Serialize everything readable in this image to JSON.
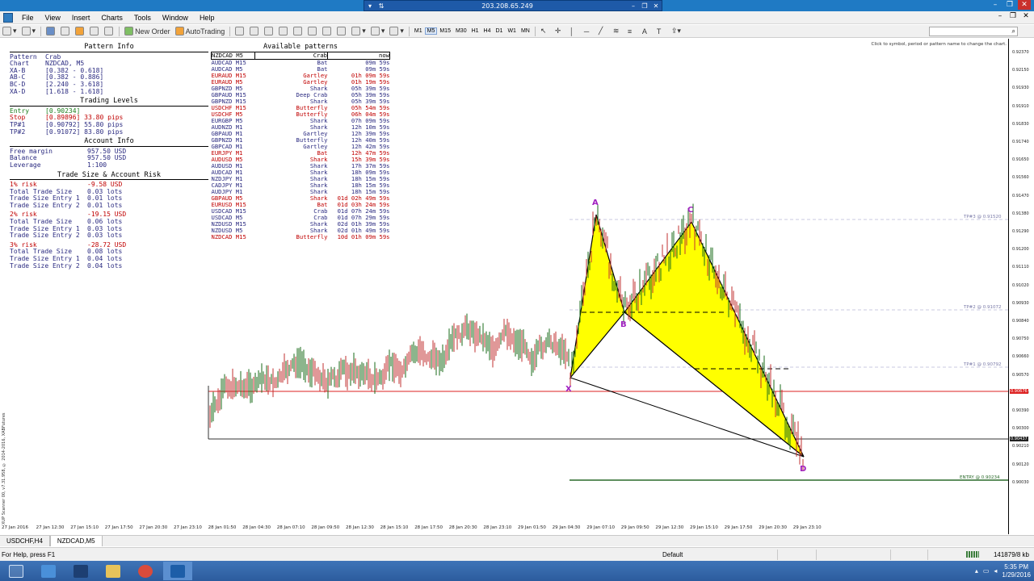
{
  "remote": {
    "address": "203.208.65.249"
  },
  "menu": {
    "items": [
      "File",
      "View",
      "Insert",
      "Charts",
      "Tools",
      "Window",
      "Help"
    ]
  },
  "toolbar": {
    "new_order": "New Order",
    "autotrading": "AutoTrading",
    "timeframes": [
      "M1",
      "M5",
      "M15",
      "M30",
      "H1",
      "H4",
      "D1",
      "W1",
      "MN"
    ]
  },
  "chart_hint": "Click to symbol, period or pattern name to change the chart.",
  "pattern_info": {
    "title": "Pattern Info",
    "rows": [
      [
        "Pattern",
        "Crab"
      ],
      [
        "Chart",
        "NZDCAD, M5"
      ],
      [
        "XA-B",
        "[0.382 - 0.618]"
      ],
      [
        "AB-C",
        "[0.382 - 0.886]"
      ],
      [
        "BC-D",
        "[2.240 - 3.618]"
      ],
      [
        "XA-D",
        "[1.618 - 1.618]"
      ]
    ],
    "levels_title": "Trading Levels",
    "levels": [
      [
        "Entry",
        "[0.90234]",
        ""
      ],
      [
        "Stop",
        "[0.89896]",
        "33.80 pips"
      ],
      [
        "TP#1",
        "[0.90792]",
        "55.80 pips"
      ],
      [
        "TP#2",
        "[0.91072]",
        "83.80 pips"
      ]
    ],
    "account_title": "Account Info",
    "account": [
      [
        "Free margin",
        "957.50 USD"
      ],
      [
        "Balance",
        "957.50 USD"
      ],
      [
        "Leverage",
        "1:100"
      ]
    ],
    "risk_title": "Trade Size & Account Risk",
    "risks": [
      {
        "label": "1% risk",
        "value": "-9.58 USD",
        "rows": [
          [
            "Total Trade Size",
            "0.03 lots"
          ],
          [
            "Trade Size Entry 1",
            "0.01 lots"
          ],
          [
            "Trade Size Entry 2",
            "0.01 lots"
          ]
        ]
      },
      {
        "label": "2% risk",
        "value": "-19.15 USD",
        "rows": [
          [
            "Total Trade Size",
            "0.06 lots"
          ],
          [
            "Trade Size Entry 1",
            "0.03 lots"
          ],
          [
            "Trade Size Entry 2",
            "0.03 lots"
          ]
        ]
      },
      {
        "label": "3% risk",
        "value": "-28.72 USD",
        "rows": [
          [
            "Total Trade Size",
            "0.08 lots"
          ],
          [
            "Trade Size Entry 1",
            "0.04 lots"
          ],
          [
            "Trade Size Entry 2",
            "0.04 lots"
          ]
        ]
      }
    ]
  },
  "patterns": {
    "title": "Available patterns",
    "header": [
      "NZDCAD M5",
      "Crab",
      "now"
    ],
    "rows": [
      [
        "AUDCAD M15",
        "Bat",
        "09m 59s",
        "navy"
      ],
      [
        "AUDCAD M5",
        "Bat",
        "09m 59s",
        "navy"
      ],
      [
        "EURAUD M15",
        "Gartley",
        "01h 09m 59s",
        "red"
      ],
      [
        "EURAUD M5",
        "Gartley",
        "01h 19m 59s",
        "red"
      ],
      [
        "GBPNZD M5",
        "Shark",
        "05h 39m 59s",
        "navy"
      ],
      [
        "GBPAUD M15",
        "Deep Crab",
        "05h 39m 59s",
        "navy"
      ],
      [
        "GBPNZD M15",
        "Shark",
        "05h 39m 59s",
        "navy"
      ],
      [
        "USDCHF M15",
        "Butterfly",
        "05h 54m 59s",
        "red"
      ],
      [
        "USDCHF M5",
        "Butterfly",
        "06h 04m 59s",
        "red"
      ],
      [
        "EURGBP M5",
        "Shark",
        "07h 09m 59s",
        "navy"
      ],
      [
        "AUDNZD M1",
        "Shark",
        "12h 10m 59s",
        "navy"
      ],
      [
        "GBPAUD M1",
        "Gartley",
        "12h 39m 59s",
        "navy"
      ],
      [
        "GBPNZD M1",
        "Butterfly",
        "12h 40m 59s",
        "navy"
      ],
      [
        "GBPCAD M1",
        "Gartley",
        "12h 42m 59s",
        "navy"
      ],
      [
        "EURJPY M1",
        "Bat",
        "12h 47m 59s",
        "red"
      ],
      [
        "AUDUSD M5",
        "Shark",
        "15h 39m 59s",
        "red"
      ],
      [
        "AUDUSD M1",
        "Shark",
        "17h 37m 59s",
        "navy"
      ],
      [
        "AUDCAD M1",
        "Shark",
        "18h 09m 59s",
        "navy"
      ],
      [
        "NZDJPY M1",
        "Shark",
        "18h 15m 59s",
        "navy"
      ],
      [
        "CADJPY M1",
        "Shark",
        "18h 15m 59s",
        "navy"
      ],
      [
        "AUDJPY M1",
        "Shark",
        "18h 15m 59s",
        "navy"
      ],
      [
        "GBPAUD M5",
        "Shark",
        "01d 02h 49m 59s",
        "red"
      ],
      [
        "EURUSD M15",
        "Bat",
        "01d 03h 24m 59s",
        "red"
      ],
      [
        "USDCAD M15",
        "Crab",
        "01d 07h 24m 59s",
        "navy"
      ],
      [
        "USDCAD M5",
        "Crab",
        "01d 07h 29m 59s",
        "navy"
      ],
      [
        "NZDUSD M15",
        "Shark",
        "02d 01h 39m 59s",
        "navy"
      ],
      [
        "NZDUSD M5",
        "Shark",
        "02d 01h 49m 59s",
        "navy"
      ],
      [
        "NZDCAD M15",
        "Butterfly",
        "10d 01h 09m 59s",
        "red"
      ]
    ]
  },
  "pattern_points": {
    "X": "X",
    "A": "A",
    "B": "B",
    "C": "C",
    "D": "D"
  },
  "levels_lines": {
    "tp3": "TP#3 @ 0.91520",
    "tp2": "TP#2 @ 0.91072",
    "tp1": "TP#1 @ 0.90792",
    "entry": "ENTRY @ 0.90234"
  },
  "y_axis": [
    "0.92370",
    "0.92150",
    "0.91930",
    "0.91910",
    "0.91830",
    "0.91740",
    "0.91650",
    "0.91560",
    "0.91470",
    "0.91380",
    "0.91290",
    "0.91200",
    "0.91110",
    "0.91020",
    "0.90930",
    "0.90840",
    "0.90750",
    "0.90660",
    "0.90570",
    "0.90480",
    "0.90390",
    "0.90300",
    "0.90210",
    "0.90120",
    "0.90030"
  ],
  "price_current": "0.90676",
  "price_bid": "0.90437",
  "x_axis": [
    "27 Jan 2016",
    "27 Jan 12:30",
    "27 Jan 15:10",
    "27 Jan 17:50",
    "27 Jan 20:30",
    "27 Jan 23:10",
    "28 Jan 01:50",
    "28 Jan 04:30",
    "28 Jan 07:10",
    "28 Jan 09:50",
    "28 Jan 12:30",
    "28 Jan 15:10",
    "28 Jan 17:50",
    "28 Jan 20:30",
    "28 Jan 23:10",
    "29 Jan 01:50",
    "29 Jan 04:30",
    "29 Jan 07:10",
    "29 Jan 09:50",
    "29 Jan 12:30",
    "29 Jan 15:10",
    "29 Jan 17:50",
    "29 Jan 20:30",
    "29 Jan 23:10"
  ],
  "side_label": "XUP Scanner 00, v7.31.958, © 2014-2016, XABFutures",
  "tabs": [
    "USDCHF,H4",
    "NZDCAD,M5"
  ],
  "status": {
    "help": "For Help, press F1",
    "profile": "Default",
    "traffic": "141879/8 kb"
  },
  "clock": {
    "time": "5:35 PM",
    "date": "1/29/2016"
  }
}
